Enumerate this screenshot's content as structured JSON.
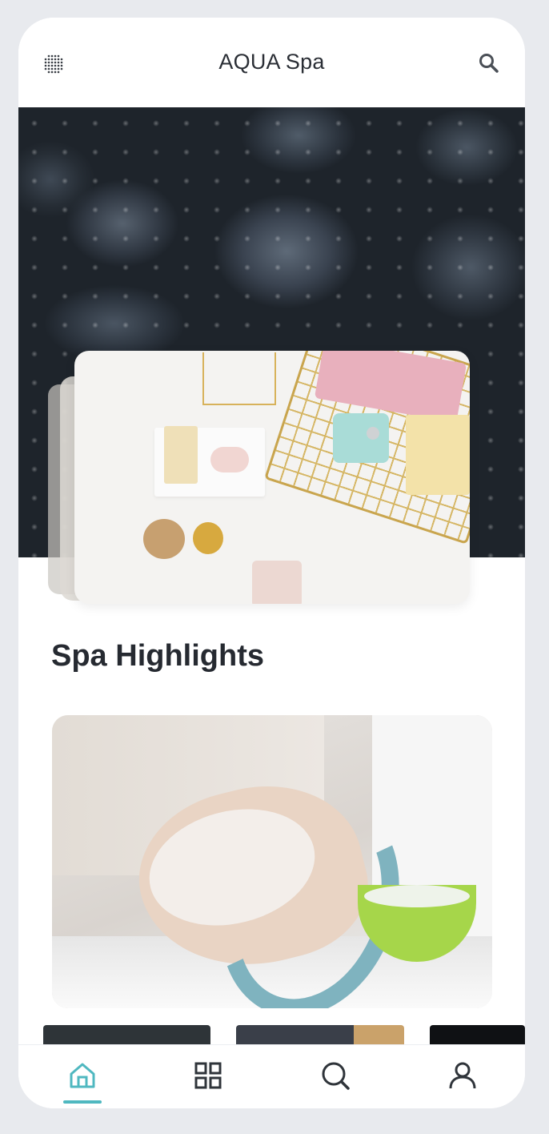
{
  "app": {
    "title": "AQUA Spa"
  },
  "header": {
    "menu_icon": "grid-dots-icon",
    "search_icon": "search-icon"
  },
  "hero": {
    "background": "black-spa-stones-with-water-drops",
    "featured_card": "spa-products-flatlay"
  },
  "sections": {
    "highlights_title": "Spa Highlights"
  },
  "highlight_card": {
    "image": "facial-mask-treatment"
  },
  "bottom_nav": {
    "items": [
      {
        "icon": "home-icon",
        "active": true
      },
      {
        "icon": "grid-icon",
        "active": false
      },
      {
        "icon": "search-icon",
        "active": false
      },
      {
        "icon": "user-icon",
        "active": false
      }
    ]
  },
  "colors": {
    "accent": "#4fb8c0",
    "text_dark": "#262a31",
    "page_bg": "#e8eaee",
    "icon_dark": "#2f343a"
  }
}
